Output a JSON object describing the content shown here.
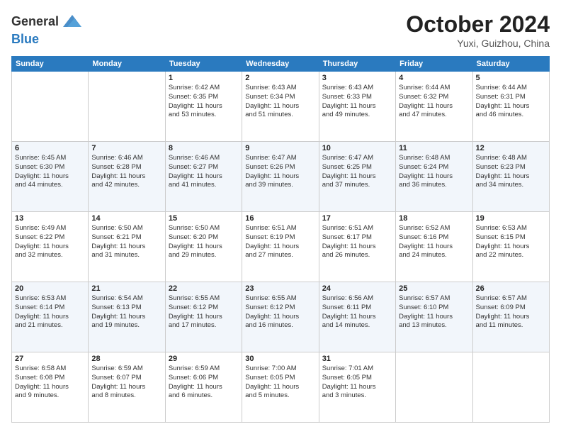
{
  "logo": {
    "general": "General",
    "blue": "Blue"
  },
  "title": "October 2024",
  "location": "Yuxi, Guizhou, China",
  "weekdays": [
    "Sunday",
    "Monday",
    "Tuesday",
    "Wednesday",
    "Thursday",
    "Friday",
    "Saturday"
  ],
  "weeks": [
    [
      {
        "day": "",
        "info": ""
      },
      {
        "day": "",
        "info": ""
      },
      {
        "day": "1",
        "info": "Sunrise: 6:42 AM\nSunset: 6:35 PM\nDaylight: 11 hours\nand 53 minutes."
      },
      {
        "day": "2",
        "info": "Sunrise: 6:43 AM\nSunset: 6:34 PM\nDaylight: 11 hours\nand 51 minutes."
      },
      {
        "day": "3",
        "info": "Sunrise: 6:43 AM\nSunset: 6:33 PM\nDaylight: 11 hours\nand 49 minutes."
      },
      {
        "day": "4",
        "info": "Sunrise: 6:44 AM\nSunset: 6:32 PM\nDaylight: 11 hours\nand 47 minutes."
      },
      {
        "day": "5",
        "info": "Sunrise: 6:44 AM\nSunset: 6:31 PM\nDaylight: 11 hours\nand 46 minutes."
      }
    ],
    [
      {
        "day": "6",
        "info": "Sunrise: 6:45 AM\nSunset: 6:30 PM\nDaylight: 11 hours\nand 44 minutes."
      },
      {
        "day": "7",
        "info": "Sunrise: 6:46 AM\nSunset: 6:28 PM\nDaylight: 11 hours\nand 42 minutes."
      },
      {
        "day": "8",
        "info": "Sunrise: 6:46 AM\nSunset: 6:27 PM\nDaylight: 11 hours\nand 41 minutes."
      },
      {
        "day": "9",
        "info": "Sunrise: 6:47 AM\nSunset: 6:26 PM\nDaylight: 11 hours\nand 39 minutes."
      },
      {
        "day": "10",
        "info": "Sunrise: 6:47 AM\nSunset: 6:25 PM\nDaylight: 11 hours\nand 37 minutes."
      },
      {
        "day": "11",
        "info": "Sunrise: 6:48 AM\nSunset: 6:24 PM\nDaylight: 11 hours\nand 36 minutes."
      },
      {
        "day": "12",
        "info": "Sunrise: 6:48 AM\nSunset: 6:23 PM\nDaylight: 11 hours\nand 34 minutes."
      }
    ],
    [
      {
        "day": "13",
        "info": "Sunrise: 6:49 AM\nSunset: 6:22 PM\nDaylight: 11 hours\nand 32 minutes."
      },
      {
        "day": "14",
        "info": "Sunrise: 6:50 AM\nSunset: 6:21 PM\nDaylight: 11 hours\nand 31 minutes."
      },
      {
        "day": "15",
        "info": "Sunrise: 6:50 AM\nSunset: 6:20 PM\nDaylight: 11 hours\nand 29 minutes."
      },
      {
        "day": "16",
        "info": "Sunrise: 6:51 AM\nSunset: 6:19 PM\nDaylight: 11 hours\nand 27 minutes."
      },
      {
        "day": "17",
        "info": "Sunrise: 6:51 AM\nSunset: 6:17 PM\nDaylight: 11 hours\nand 26 minutes."
      },
      {
        "day": "18",
        "info": "Sunrise: 6:52 AM\nSunset: 6:16 PM\nDaylight: 11 hours\nand 24 minutes."
      },
      {
        "day": "19",
        "info": "Sunrise: 6:53 AM\nSunset: 6:15 PM\nDaylight: 11 hours\nand 22 minutes."
      }
    ],
    [
      {
        "day": "20",
        "info": "Sunrise: 6:53 AM\nSunset: 6:14 PM\nDaylight: 11 hours\nand 21 minutes."
      },
      {
        "day": "21",
        "info": "Sunrise: 6:54 AM\nSunset: 6:13 PM\nDaylight: 11 hours\nand 19 minutes."
      },
      {
        "day": "22",
        "info": "Sunrise: 6:55 AM\nSunset: 6:12 PM\nDaylight: 11 hours\nand 17 minutes."
      },
      {
        "day": "23",
        "info": "Sunrise: 6:55 AM\nSunset: 6:12 PM\nDaylight: 11 hours\nand 16 minutes."
      },
      {
        "day": "24",
        "info": "Sunrise: 6:56 AM\nSunset: 6:11 PM\nDaylight: 11 hours\nand 14 minutes."
      },
      {
        "day": "25",
        "info": "Sunrise: 6:57 AM\nSunset: 6:10 PM\nDaylight: 11 hours\nand 13 minutes."
      },
      {
        "day": "26",
        "info": "Sunrise: 6:57 AM\nSunset: 6:09 PM\nDaylight: 11 hours\nand 11 minutes."
      }
    ],
    [
      {
        "day": "27",
        "info": "Sunrise: 6:58 AM\nSunset: 6:08 PM\nDaylight: 11 hours\nand 9 minutes."
      },
      {
        "day": "28",
        "info": "Sunrise: 6:59 AM\nSunset: 6:07 PM\nDaylight: 11 hours\nand 8 minutes."
      },
      {
        "day": "29",
        "info": "Sunrise: 6:59 AM\nSunset: 6:06 PM\nDaylight: 11 hours\nand 6 minutes."
      },
      {
        "day": "30",
        "info": "Sunrise: 7:00 AM\nSunset: 6:05 PM\nDaylight: 11 hours\nand 5 minutes."
      },
      {
        "day": "31",
        "info": "Sunrise: 7:01 AM\nSunset: 6:05 PM\nDaylight: 11 hours\nand 3 minutes."
      },
      {
        "day": "",
        "info": ""
      },
      {
        "day": "",
        "info": ""
      }
    ]
  ]
}
